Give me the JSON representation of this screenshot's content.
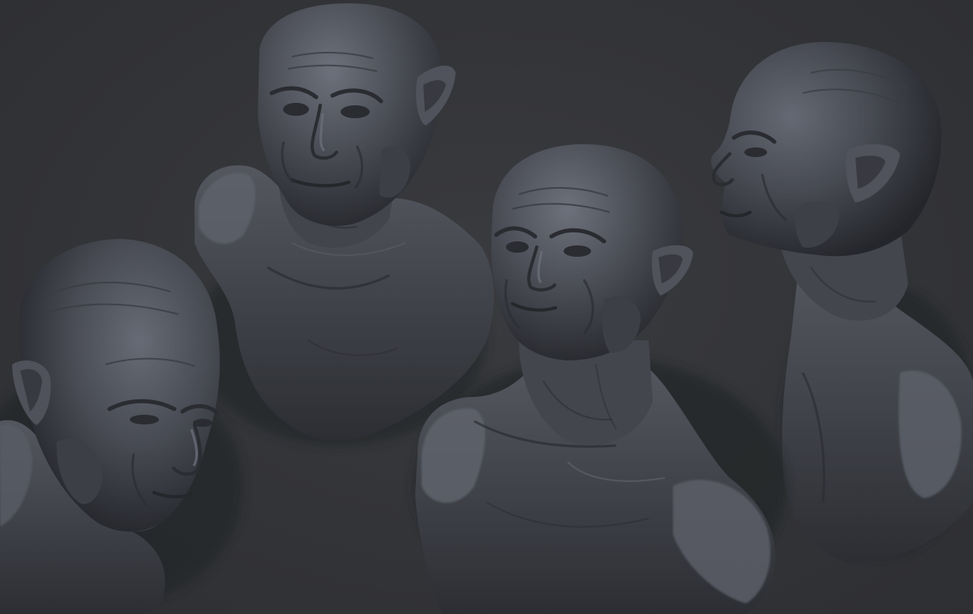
{
  "scene": {
    "background_color": "#333438",
    "material_color": "#4a4d55",
    "highlight_color": "#6d717b",
    "shadow_color": "#23252a",
    "models": [
      {
        "name": "bust-view-left",
        "icon": "sculpted-bust"
      },
      {
        "name": "bust-view-top-center",
        "icon": "sculpted-bust"
      },
      {
        "name": "bust-view-center",
        "icon": "sculpted-bust"
      },
      {
        "name": "bust-view-right",
        "icon": "sculpted-bust"
      }
    ]
  }
}
